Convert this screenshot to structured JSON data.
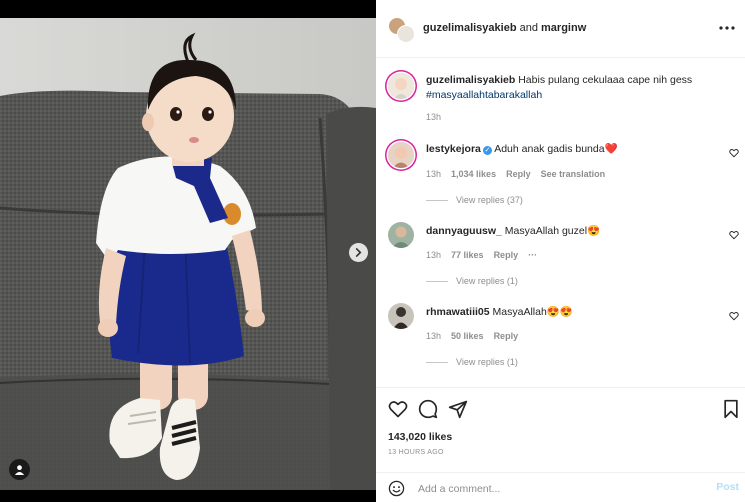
{
  "post": {
    "header": {
      "owner": "guzelimalisyakieb",
      "joiner": "and",
      "collaborator": "marginw"
    },
    "caption": {
      "username": "guzelimalisyakieb",
      "text": "Habis pulang cekulaaa cape nih gess",
      "hashtag": "#masyaallahtabarakallah",
      "time": "13h"
    },
    "comments": [
      {
        "username": "lestykejora",
        "verified": true,
        "text": "Aduh anak gadis bunda❤️",
        "time": "13h",
        "likes": "1,034 likes",
        "reply_label": "Reply",
        "translate_label": "See translation",
        "view_replies": "View replies (37)"
      },
      {
        "username": "dannyaguusw_",
        "text": "MasyaAllah guzel😍",
        "time": "13h",
        "likes": "77 likes",
        "reply_label": "Reply",
        "more": "···",
        "view_replies": "View replies (1)"
      },
      {
        "username": "rhmawatiii05",
        "text": "MasyaAllah😍😍",
        "time": "13h",
        "likes": "50 likes",
        "reply_label": "Reply",
        "view_replies": "View replies (1)"
      }
    ],
    "likes_count": "143,020 likes",
    "time_ago": "13 HOURS AGO",
    "add_comment": {
      "placeholder": "Add a comment...",
      "post_label": "Post"
    }
  },
  "colors": {
    "accent_blue": "#0095f6",
    "hashtag": "#00376b",
    "muted": "#8e8e8e",
    "post_disabled": "#b2dffc",
    "heart_red": "#ed4956",
    "verified": "#3897f0"
  },
  "icons": {
    "like": "heart-icon",
    "comment": "comment-bubble-icon",
    "share": "paper-plane-icon",
    "save": "bookmark-icon",
    "more": "ellipsis-icon",
    "emoji": "smiley-icon",
    "next": "chevron-right-icon",
    "tags": "user-tag-icon"
  }
}
